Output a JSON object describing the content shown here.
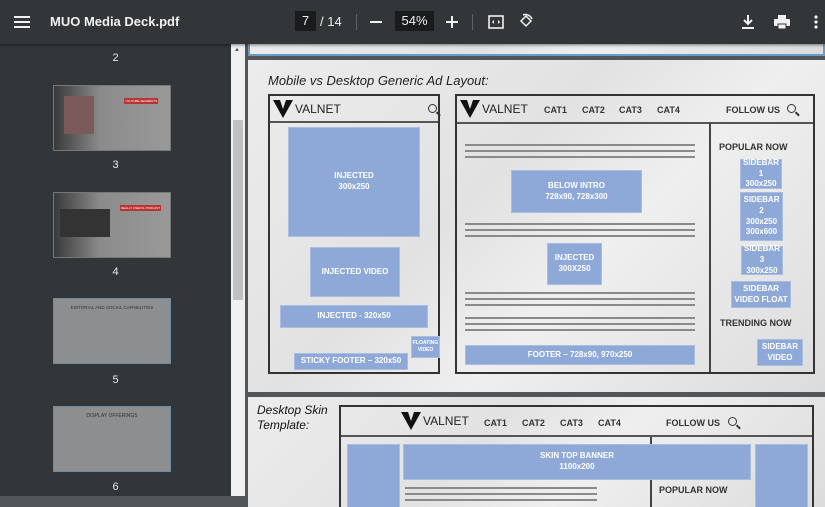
{
  "toolbar": {
    "title": "MUO Media Deck.pdf",
    "page_current": "7",
    "page_total": "/ 14",
    "zoom": "54%"
  },
  "sidebar": {
    "thumbnails": [
      {
        "label": "2"
      },
      {
        "label": "3",
        "heading": "YOUTUBE SEGMENTS"
      },
      {
        "label": "4",
        "heading": "REALLY USEFUL PODCAST"
      },
      {
        "label": "5",
        "heading": "EDITORIAL AND SOCIAL CAPABILITIES"
      },
      {
        "label": "6",
        "heading": "DISPLAY OFFERINGS"
      }
    ]
  },
  "page7": {
    "title": "Mobile vs Desktop Generic Ad Layout:",
    "brand": "VALNET",
    "mobile": {
      "injected": [
        "INJECTED",
        "300x250"
      ],
      "video": "INJECTED VIDEO",
      "banner": "INJECTED - 320x50",
      "floating": [
        "FLOATING",
        "VIDEO"
      ],
      "sticky": "STICKY FOOTER – 320x50"
    },
    "desktop": {
      "cats": [
        "CAT1",
        "CAT2",
        "CAT3",
        "CAT4"
      ],
      "follow": "FOLLOW US",
      "below_intro": [
        "BELOW INTRO",
        "728x90, 728x300"
      ],
      "injected": [
        "INJECTED",
        "300X250"
      ],
      "footer": "FOOTER – 728x90, 970x250",
      "popular": "POPULAR NOW",
      "sidebar1": [
        "SIDEBAR 1",
        "300x250"
      ],
      "sidebar2": [
        "SIDEBAR 2",
        "300x250",
        "300x600"
      ],
      "sidebar3": [
        "SIDEBAR 3",
        "300x250"
      ],
      "video_float": [
        "SIDEBAR",
        "VIDEO FLOAT"
      ],
      "trending": "TRENDING NOW",
      "sidebar_video": [
        "SIDEBAR",
        "VIDEO"
      ]
    }
  },
  "page8": {
    "title": [
      "Desktop Skin",
      "Template:"
    ],
    "brand": "VALNET",
    "cats": [
      "CAT1",
      "CAT2",
      "CAT3",
      "CAT4"
    ],
    "follow": "FOLLOW US",
    "banner": [
      "SKIN TOP BANNER",
      "1100x200"
    ],
    "popular": "POPULAR NOW"
  },
  "colors": {
    "toolbar": "#323639",
    "ad_block": "#8ea9d8",
    "viewer_bg": "#525659"
  }
}
